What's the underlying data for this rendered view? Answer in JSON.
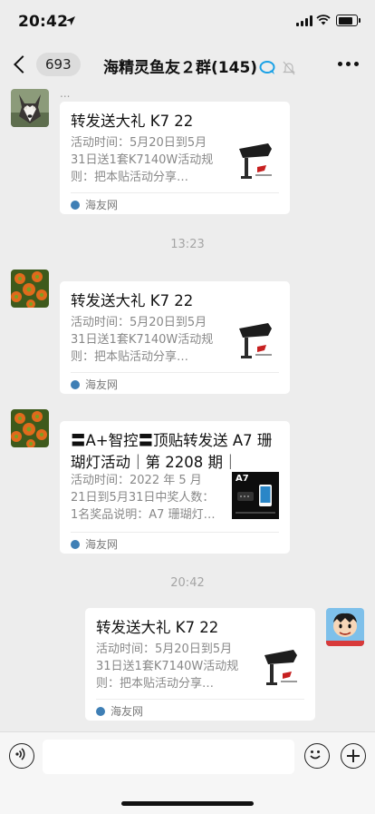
{
  "status_bar": {
    "time": "20:42"
  },
  "header": {
    "back_count": "693",
    "title": "海精灵鱼友２群(145)"
  },
  "messages": [
    {
      "title": "转发送大礼 K7 22",
      "desc": "活动时间：5月20日到5月31日送1套K7140W活动规则：把本贴活动分享…",
      "source": "海友网"
    },
    {
      "title": "转发送大礼 K7 22",
      "desc": "活动时间：5月20日到5月31日送1套K7140W活动规则：把本贴活动分享…",
      "source": "海友网"
    },
    {
      "title": "〓A+智控〓顶贴转发送 A7 珊瑚灯活动｜第 2208 期｜",
      "desc": "活动时间：2022 年 5 月21日到5月31日中奖人数：1名奖品说明：A7 珊瑚灯…",
      "source": "海友网",
      "thumb_label": "A7"
    },
    {
      "title": "转发送大礼 K7 22",
      "desc": "活动时间：5月20日到5月31日送1套K7140W活动规则：把本贴活动分享…",
      "source": "海友网"
    }
  ],
  "timestamps": [
    "13:23",
    "20:42"
  ],
  "truncated_name": "...",
  "colors": {
    "background": "#ededed",
    "card": "#ffffff",
    "muted": "#888888",
    "accent": "#3f7fb5"
  }
}
